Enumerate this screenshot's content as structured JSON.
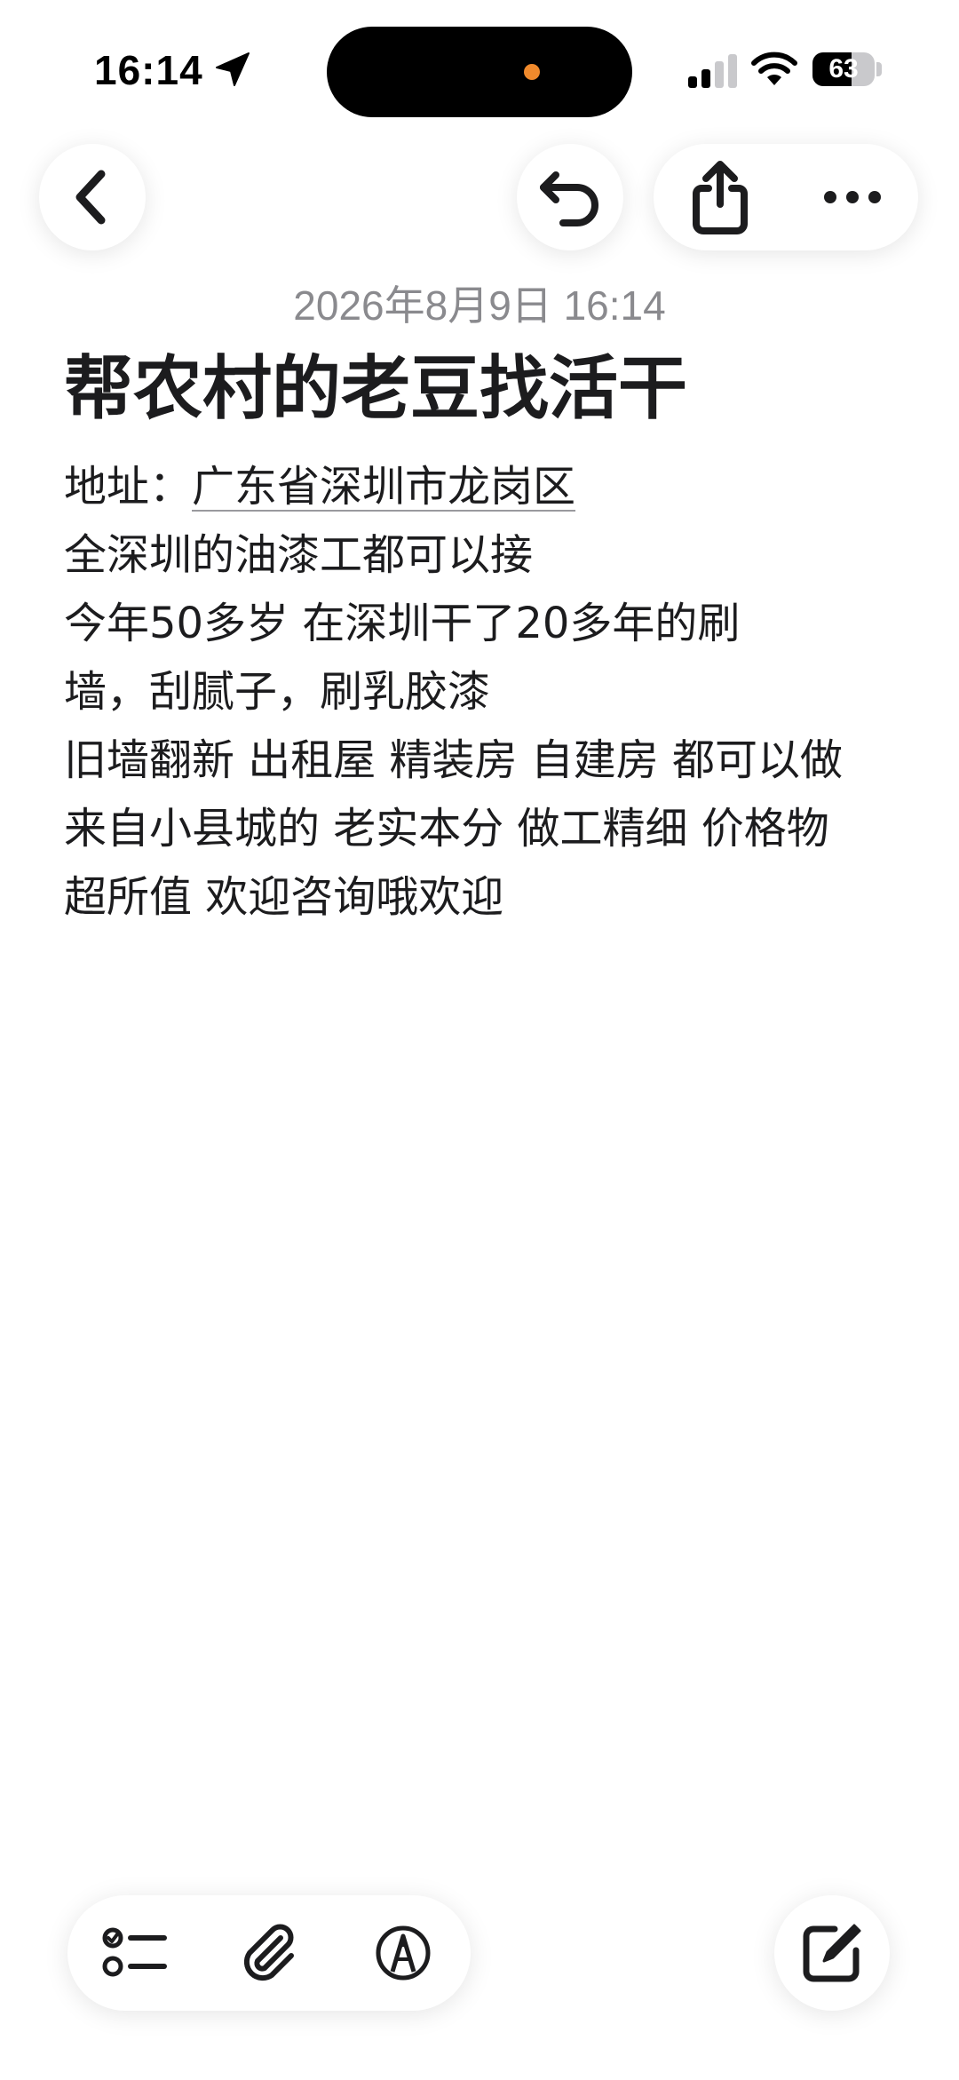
{
  "status_bar": {
    "time": "16:14",
    "battery_level": "63",
    "battery_fraction": 0.63,
    "location_icon": "location-arrow-icon",
    "signal_icon": "cellular-signal-icon",
    "wifi_icon": "wifi-icon"
  },
  "toolbar": {
    "back_icon": "chevron-left-icon",
    "undo_icon": "undo-icon",
    "share_icon": "share-icon",
    "more_icon": "ellipsis-icon"
  },
  "note": {
    "date": "2026年8月9日 16:14",
    "title": "帮农村的老豆找活干",
    "address_label": "地址：",
    "address_value": "广东省深圳市龙岗区",
    "lines": [
      "全深圳的油漆工都可以接",
      "今年50多岁 在深圳干了20多年的刷",
      "墙，刮腻子，刷乳胶漆",
      "旧墙翻新 出租屋 精装房 自建房 都可以做",
      "来自小县城的 老实本分 做工精细 价格物",
      "超所值 欢迎咨询哦欢迎"
    ]
  },
  "bottom_toolbar": {
    "checklist_icon": "checklist-icon",
    "attachment_icon": "paperclip-icon",
    "markup_icon": "markup-pen-icon",
    "compose_icon": "compose-icon"
  },
  "colors": {
    "text": "#1c1c1e",
    "date_gray": "#8a8a8e",
    "island_indicator": "#f08a2c",
    "background": "#ffffff"
  }
}
